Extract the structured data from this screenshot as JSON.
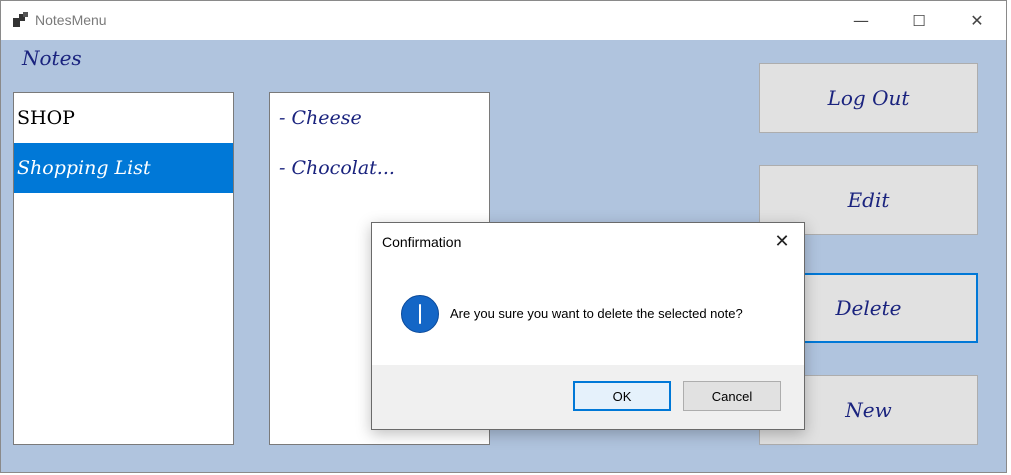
{
  "window": {
    "title": "NotesMenu",
    "controls": {
      "minimize": "—",
      "maximize": "☐",
      "close": "✕"
    }
  },
  "notes_label": "Notes",
  "notes_list": [
    {
      "label": "SHOP",
      "selected": false
    },
    {
      "label": "Shopping List",
      "selected": true
    }
  ],
  "note_content": [
    "- Cheese",
    "- Chocolat..."
  ],
  "buttons": {
    "logout": "Log Out",
    "edit": "Edit",
    "delete": "Delete",
    "new": "New"
  },
  "dialog": {
    "title": "Confirmation",
    "close_glyph": "✕",
    "icon": "info-icon",
    "message": "Are you sure you want to delete the selected note?",
    "ok": "OK",
    "cancel": "Cancel"
  },
  "colors": {
    "background": "#b0c4de",
    "selection": "#0078d7",
    "text_accent": "#1a237e"
  }
}
